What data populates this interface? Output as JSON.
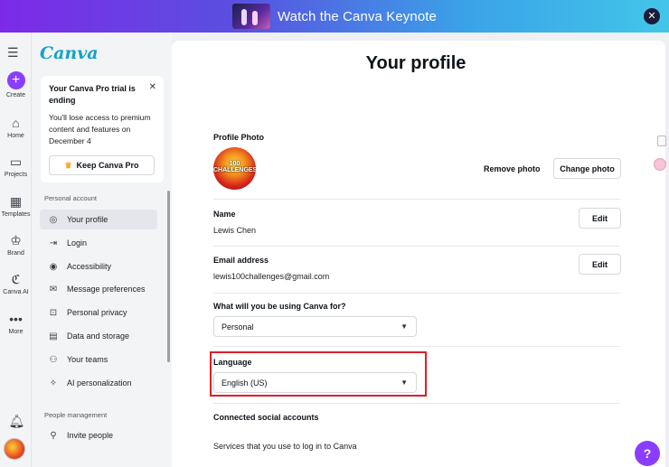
{
  "banner": {
    "text": "Watch the Canva Keynote",
    "close": "✕"
  },
  "rail": {
    "menu_icon": "☰",
    "items": [
      {
        "label": "Create",
        "icon": "plus-icon"
      },
      {
        "label": "Home",
        "icon": "home-icon"
      },
      {
        "label": "Projects",
        "icon": "folder-icon"
      },
      {
        "label": "Templates",
        "icon": "templates-icon"
      },
      {
        "label": "Brand",
        "icon": "brand-icon"
      },
      {
        "label": "Canva AI",
        "icon": "canva-ai-icon"
      },
      {
        "label": "More",
        "icon": "more-icon"
      }
    ]
  },
  "sidebar": {
    "logo": "Canva",
    "trial": {
      "title": "Your Canva Pro trial is ending",
      "body": "You'll lose access to premium content and features on December 4",
      "button": "Keep Canva Pro"
    },
    "personal_label": "Personal account",
    "personal_items": [
      {
        "label": "Your profile",
        "icon": "user-icon",
        "active": true
      },
      {
        "label": "Login",
        "icon": "login-icon"
      },
      {
        "label": "Accessibility",
        "icon": "accessibility-icon"
      },
      {
        "label": "Message preferences",
        "icon": "mail-icon"
      },
      {
        "label": "Personal privacy",
        "icon": "lock-icon"
      },
      {
        "label": "Data and storage",
        "icon": "database-icon"
      },
      {
        "label": "Your teams",
        "icon": "teams-icon"
      },
      {
        "label": "AI personalization",
        "icon": "ai-icon"
      }
    ],
    "people_label": "People management",
    "people_items": [
      {
        "label": "Invite people",
        "icon": "user-plus-icon"
      }
    ]
  },
  "profile": {
    "title": "Your profile",
    "photo_label": "Profile Photo",
    "photo_overlay": "100 CHALLENGES",
    "remove_photo": "Remove photo",
    "change_photo": "Change photo",
    "name_label": "Name",
    "name_value": "Lewis Chen",
    "email_label": "Email address",
    "email_value": "lewis100challenges@gmail.com",
    "edit": "Edit",
    "usage_label": "What will you be using Canva for?",
    "usage_value": "Personal",
    "language_label": "Language",
    "language_value": "English (US)",
    "social_label": "Connected social accounts",
    "social_desc": "Services that you use to log in to Canva"
  },
  "help": "?",
  "colors": {
    "accent": "#8b3dff",
    "highlight": "#d8222a",
    "logo": "#13a3c9"
  }
}
